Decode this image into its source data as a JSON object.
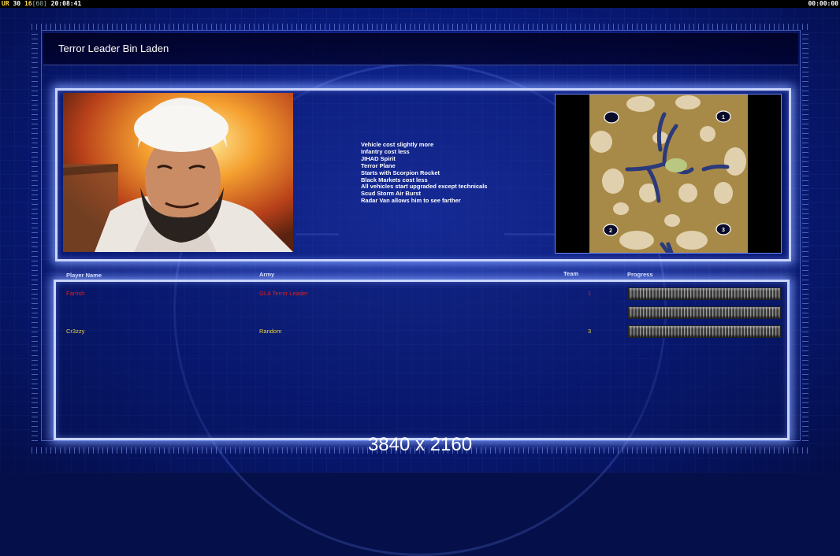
{
  "status_bar": {
    "left_label": "UR",
    "fps_a": "30",
    "fps_b": "16",
    "fps_c": "[60]",
    "clock": "20:08:41",
    "right_time": "00:00:00"
  },
  "window": {
    "title": "Terror Leader Bin Laden"
  },
  "abilities": [
    "Vehicle cost slightly more",
    "Infantry cost less",
    "JIHAD Spirit",
    "Terror Plane",
    "Starts with Scorpion Rocket",
    "Black Markets cost less",
    "All vehicles start upgraded except technicals",
    "Scud Storm Air Burst",
    "Radar Van allows him to see farther"
  ],
  "map": {
    "start_positions": [
      "1",
      "2",
      "3"
    ]
  },
  "table": {
    "headers": {
      "player": "Player Name",
      "army": "Army",
      "team": "Team",
      "progress": "Progress"
    },
    "rows": [
      {
        "name": "Farrish",
        "army": "GLA Terror Leader",
        "team": "1",
        "color": "#e0201a",
        "progress": 1.0
      },
      {
        "name": "",
        "army": "",
        "team": "",
        "color": "#ffffff",
        "progress": 1.0
      },
      {
        "name": "Cr3zzy",
        "army": "Random",
        "team": "3",
        "color": "#e8d23a",
        "progress": 1.0
      }
    ]
  },
  "resolution_label": "3840 x 2160",
  "colors": {
    "accent": "#c8d4ff",
    "background": "#081a78"
  }
}
